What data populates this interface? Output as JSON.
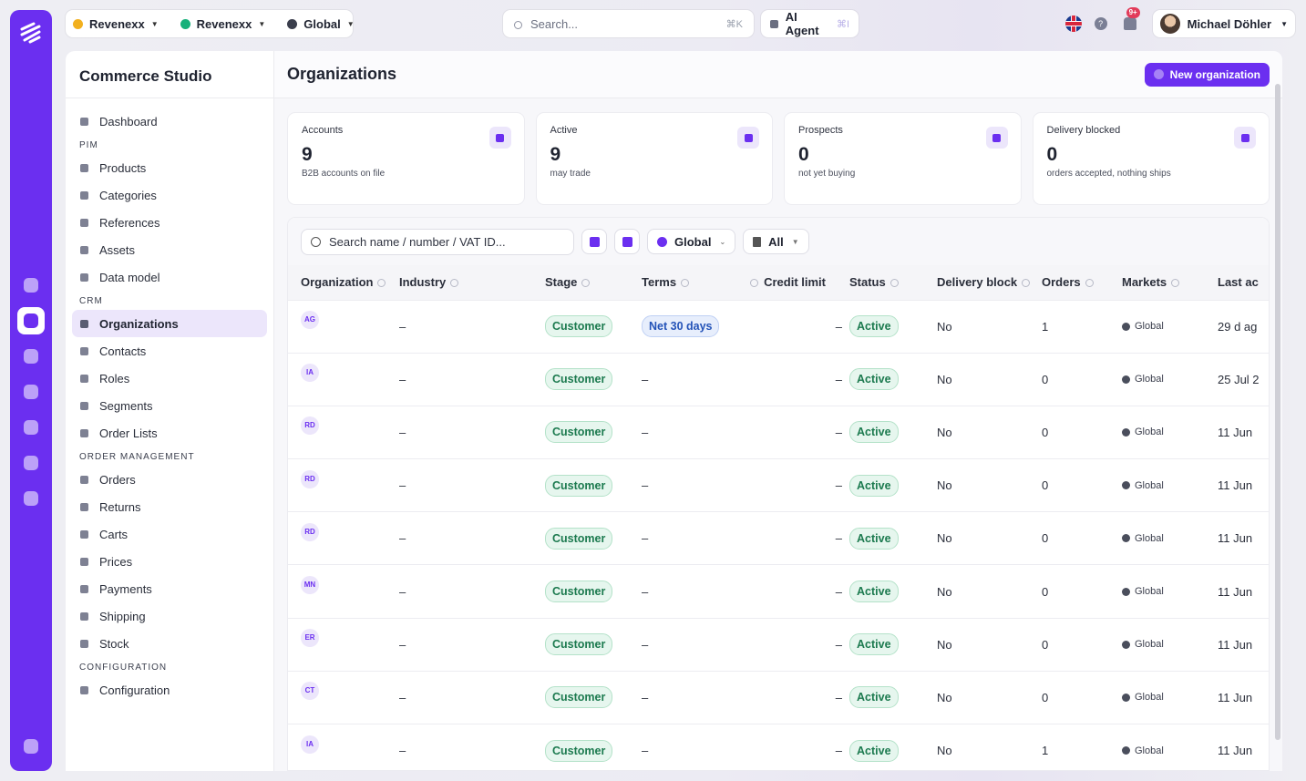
{
  "topbar": {
    "contexts": [
      {
        "label": "Revenexx",
        "color": "#f2b01e"
      },
      {
        "label": "Revenexx",
        "color": "#16b07a"
      },
      {
        "label": "Global",
        "color": "#3a3e4c"
      }
    ],
    "search_placeholder": "Search...",
    "search_shortcut": "⌘K",
    "ai_agent_label": "AI Agent",
    "ai_agent_shortcut": "⌘I",
    "notifications_badge": "9+",
    "user_name": "Michael Döhler"
  },
  "sidebar": {
    "brand": "Commerce Studio",
    "sections": [
      {
        "title": "",
        "items": [
          {
            "label": "Dashboard",
            "icon": "dashboard-icon"
          }
        ]
      },
      {
        "title": "PIM",
        "items": [
          {
            "label": "Products",
            "icon": "box-icon"
          },
          {
            "label": "Categories",
            "icon": "tag-icon"
          },
          {
            "label": "References",
            "icon": "link-icon"
          },
          {
            "label": "Assets",
            "icon": "image-icon"
          },
          {
            "label": "Data model",
            "icon": "grid-icon"
          }
        ]
      },
      {
        "title": "CRM",
        "items": [
          {
            "label": "Organizations",
            "icon": "building-icon",
            "selected": true
          },
          {
            "label": "Contacts",
            "icon": "contact-icon"
          },
          {
            "label": "Roles",
            "icon": "shield-icon"
          },
          {
            "label": "Segments",
            "icon": "users-icon"
          },
          {
            "label": "Order Lists",
            "icon": "bookmark-icon"
          }
        ]
      },
      {
        "title": "ORDER MANAGEMENT",
        "items": [
          {
            "label": "Orders",
            "icon": "box-icon"
          },
          {
            "label": "Returns",
            "icon": "undo-icon"
          },
          {
            "label": "Carts",
            "icon": "cart-icon"
          },
          {
            "label": "Prices",
            "icon": "price-tag-icon"
          },
          {
            "label": "Payments",
            "icon": "card-icon"
          },
          {
            "label": "Shipping",
            "icon": "truck-icon"
          },
          {
            "label": "Stock",
            "icon": "stock-icon"
          }
        ]
      },
      {
        "title": "CONFIGURATION",
        "items": [
          {
            "label": "Configuration",
            "icon": "gear-icon"
          }
        ]
      }
    ]
  },
  "header": {
    "title": "Organizations",
    "new_button": "New organization"
  },
  "stats": [
    {
      "label": "Accounts",
      "value": "9",
      "sub": "B2B accounts on file",
      "icon": "building-icon"
    },
    {
      "label": "Active",
      "value": "9",
      "sub": "may trade",
      "icon": "check-icon"
    },
    {
      "label": "Prospects",
      "value": "0",
      "sub": "not yet buying",
      "icon": "chart-icon"
    },
    {
      "label": "Delivery blocked",
      "value": "0",
      "sub": "orders accepted, nothing ships",
      "icon": "warning-icon"
    }
  ],
  "filters": {
    "search_placeholder": "Search name / number / VAT ID...",
    "market": "Global",
    "status": "All"
  },
  "table": {
    "columns": [
      "Organization",
      "Industry",
      "Stage",
      "Terms",
      "Credit limit",
      "Status",
      "Delivery block",
      "Orders",
      "Markets",
      "Last ac"
    ],
    "rows": [
      {
        "initials": "AG",
        "industry": "–",
        "stage": "Customer",
        "terms": "Net 30 days",
        "credit": "–",
        "status": "Active",
        "block": "No",
        "orders": "1",
        "market": "Global",
        "last": "29 d ag"
      },
      {
        "initials": "IA",
        "industry": "–",
        "stage": "Customer",
        "terms": "–",
        "credit": "–",
        "status": "Active",
        "block": "No",
        "orders": "0",
        "market": "Global",
        "last": "25 Jul 2"
      },
      {
        "initials": "RD",
        "industry": "–",
        "stage": "Customer",
        "terms": "–",
        "credit": "–",
        "status": "Active",
        "block": "No",
        "orders": "0",
        "market": "Global",
        "last": "11 Jun"
      },
      {
        "initials": "RD",
        "industry": "–",
        "stage": "Customer",
        "terms": "–",
        "credit": "–",
        "status": "Active",
        "block": "No",
        "orders": "0",
        "market": "Global",
        "last": "11 Jun"
      },
      {
        "initials": "RD",
        "industry": "–",
        "stage": "Customer",
        "terms": "–",
        "credit": "–",
        "status": "Active",
        "block": "No",
        "orders": "0",
        "market": "Global",
        "last": "11 Jun"
      },
      {
        "initials": "MN",
        "industry": "–",
        "stage": "Customer",
        "terms": "–",
        "credit": "–",
        "status": "Active",
        "block": "No",
        "orders": "0",
        "market": "Global",
        "last": "11 Jun"
      },
      {
        "initials": "ER",
        "industry": "–",
        "stage": "Customer",
        "terms": "–",
        "credit": "–",
        "status": "Active",
        "block": "No",
        "orders": "0",
        "market": "Global",
        "last": "11 Jun"
      },
      {
        "initials": "CT",
        "industry": "–",
        "stage": "Customer",
        "terms": "–",
        "credit": "–",
        "status": "Active",
        "block": "No",
        "orders": "0",
        "market": "Global",
        "last": "11 Jun"
      },
      {
        "initials": "IA",
        "industry": "–",
        "stage": "Customer",
        "terms": "–",
        "credit": "–",
        "status": "Active",
        "block": "No",
        "orders": "1",
        "market": "Global",
        "last": "11 Jun"
      }
    ]
  },
  "colors": {
    "accent": "#6b2ff0",
    "success": "#1c7a4f",
    "info": "#2453b8"
  }
}
